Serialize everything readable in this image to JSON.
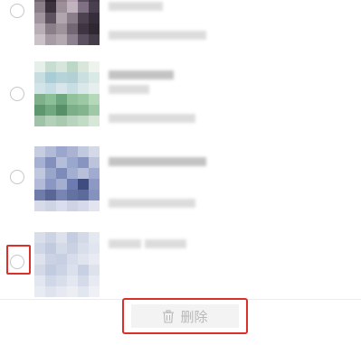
{
  "bottom_bar": {
    "delete_label": "删除"
  },
  "colors": {
    "annotation": "#d9302c",
    "radio_border": "#c7c7c7",
    "button_bg": "#f3f3f3",
    "button_text": "#b8b8b8"
  }
}
